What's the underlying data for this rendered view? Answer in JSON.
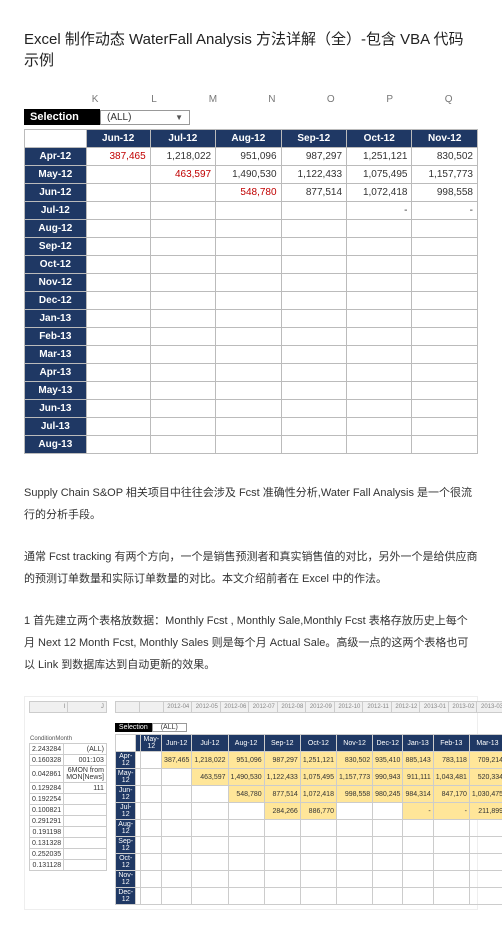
{
  "title": "Excel 制作动态 WaterFall Analysis 方法详解（全）-包含 VBA 代码示例",
  "upper_sheet": {
    "col_letters": [
      "K",
      "L",
      "M",
      "N",
      "O",
      "P",
      "Q"
    ],
    "selection_label": "Selection",
    "selection_value": "(ALL)",
    "col_headers": [
      "Jun-12",
      "Jul-12",
      "Aug-12",
      "Sep-12",
      "Oct-12",
      "Nov-12"
    ],
    "rows": [
      {
        "label": "Apr-12",
        "cells": [
          "387,465",
          "1,218,022",
          "951,096",
          "987,297",
          "1,251,121",
          "830,502"
        ]
      },
      {
        "label": "May-12",
        "cells": [
          "",
          "463,597",
          "1,490,530",
          "1,122,433",
          "1,075,495",
          "1,157,773"
        ]
      },
      {
        "label": "Jun-12",
        "cells": [
          "",
          "",
          "548,780",
          "877,514",
          "1,072,418",
          "998,558"
        ]
      },
      {
        "label": "Jul-12",
        "cells": [
          "",
          "",
          "",
          "",
          "-",
          "-"
        ]
      },
      {
        "label": "Aug-12",
        "cells": [
          "",
          "",
          "",
          "",
          "",
          ""
        ]
      },
      {
        "label": "Sep-12",
        "cells": [
          "",
          "",
          "",
          "",
          "",
          ""
        ]
      },
      {
        "label": "Oct-12",
        "cells": [
          "",
          "",
          "",
          "",
          "",
          ""
        ]
      },
      {
        "label": "Nov-12",
        "cells": [
          "",
          "",
          "",
          "",
          "",
          ""
        ]
      },
      {
        "label": "Dec-12",
        "cells": [
          "",
          "",
          "",
          "",
          "",
          ""
        ]
      },
      {
        "label": "Jan-13",
        "cells": [
          "",
          "",
          "",
          "",
          "",
          ""
        ]
      },
      {
        "label": "Feb-13",
        "cells": [
          "",
          "",
          "",
          "",
          "",
          ""
        ]
      },
      {
        "label": "Mar-13",
        "cells": [
          "",
          "",
          "",
          "",
          "",
          ""
        ]
      },
      {
        "label": "Apr-13",
        "cells": [
          "",
          "",
          "",
          "",
          "",
          ""
        ]
      },
      {
        "label": "May-13",
        "cells": [
          "",
          "",
          "",
          "",
          "",
          ""
        ]
      },
      {
        "label": "Jun-13",
        "cells": [
          "",
          "",
          "",
          "",
          "",
          ""
        ]
      },
      {
        "label": "Jul-13",
        "cells": [
          "",
          "",
          "",
          "",
          "",
          ""
        ]
      },
      {
        "label": "Aug-13",
        "cells": [
          "",
          "",
          "",
          "",
          "",
          ""
        ]
      }
    ]
  },
  "paragraphs": {
    "p1": "Supply Chain S&OP 相关项目中往往会涉及 Fcst 准确性分析,Water Fall Analysis 是一个很流行的分析手段。",
    "p2": "通常 Fcst tracking 有两个方向，一个是销售预测者和真实销售值的对比，另外一个是给供应商的预测订单数量和实际订单数量的对比。本文介绍前者在 Excel 中的作法。",
    "p3": "1 首先建立两个表格放数据：Monthly Fcst , Monthly Sale,Monthly Fcst 表格存放历史上每个月 Next 12 Month Fcst, Monthly Sales 则是每个月 Actual Sale。高级一点的这两个表格也可以 Link 到数据库达到自动更新的效果。"
  },
  "lower_sheet": {
    "col_letters_left": [
      "I",
      "J"
    ],
    "col_letters_right": [
      "",
      "",
      "2012-04",
      "2012-05",
      "2012-06",
      "2012-07",
      "2012-08",
      "2012-09",
      "2012-10",
      "2012-11",
      "2012-12",
      "2013-01",
      "2013-02",
      "2013-03"
    ],
    "left_header": "ConditionMonth",
    "left_rows": [
      [
        "2.243284",
        "(ALL)"
      ],
      [
        "0.160328",
        "001:103"
      ],
      [
        "0.042861",
        "6MON from MON[News]"
      ],
      [
        "0.129284",
        "111"
      ],
      [
        "0.192254",
        ""
      ],
      [
        "0.100821",
        ""
      ],
      [
        "0.291291",
        ""
      ],
      [
        "0.191198",
        ""
      ],
      [
        "0.131328",
        ""
      ],
      [
        "0.252035",
        ""
      ],
      [
        "0.131128",
        ""
      ]
    ],
    "selection_label": "Selection",
    "selection_value": "(ALL)",
    "right_col_headers": [
      "",
      "May-12",
      "Jun-12",
      "Jul-12",
      "Aug-12",
      "Sep-12",
      "Oct-12",
      "Nov-12",
      "Dec-12",
      "Jan-13",
      "Feb-13",
      "Mar-13"
    ],
    "right_rows": [
      {
        "label": "Apr-12",
        "cells": [
          "",
          "",
          "387,465",
          "1,218,022",
          "951,096",
          "987,297",
          "1,251,121",
          "830,502",
          "935,410",
          "885,143",
          "783,118",
          "709,214"
        ]
      },
      {
        "label": "May-12",
        "cells": [
          "",
          "",
          "",
          "463,597",
          "1,490,530",
          "1,122,433",
          "1,075,495",
          "1,157,773",
          "990,943",
          "911,111",
          "1,043,481",
          "520,334"
        ]
      },
      {
        "label": "Jun-12",
        "cells": [
          "",
          "",
          "",
          "",
          "548,780",
          "877,514",
          "1,072,418",
          "998,558",
          "980,245",
          "984,314",
          "847,170",
          "1,030,475"
        ]
      },
      {
        "label": "Jul-12",
        "cells": [
          "",
          "",
          "",
          "",
          "",
          "284,266",
          "886,770",
          "",
          "",
          "-",
          "-",
          "211,899"
        ]
      },
      {
        "label": "Aug-12",
        "cells": [
          "",
          "",
          "",
          "",
          "",
          "",
          "",
          "",
          "",
          "",
          "",
          ""
        ]
      },
      {
        "label": "Sep-12",
        "cells": [
          "",
          "",
          "",
          "",
          "",
          "",
          "",
          "",
          "",
          "",
          "",
          ""
        ]
      },
      {
        "label": "Oct-12",
        "cells": [
          "",
          "",
          "",
          "",
          "",
          "",
          "",
          "",
          "",
          "",
          "",
          ""
        ]
      },
      {
        "label": "Nov-12",
        "cells": [
          "",
          "",
          "",
          "",
          "",
          "",
          "",
          "",
          "",
          "",
          "",
          ""
        ]
      },
      {
        "label": "Dec-12",
        "cells": [
          "",
          "",
          "",
          "",
          "",
          "",
          "",
          "",
          "",
          "",
          "",
          ""
        ]
      }
    ]
  }
}
